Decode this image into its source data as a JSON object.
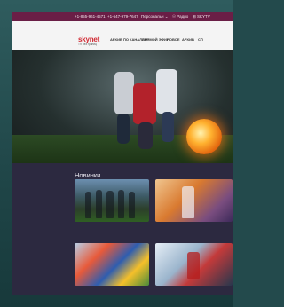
{
  "topbar": {
    "phone1": "+1-855-961-4571",
    "phone2": "+1-647-979-7647",
    "account": "Персональн ⌄",
    "radio": "☉ Радио",
    "extra": "⊞ SKYTV"
  },
  "header": {
    "logo_main": "skynet",
    "logo_sub": "TV без границ",
    "nav": [
      "АРХИВ ПО КАНАЛАМ",
      "ПРЯМОЙ ЭФИР",
      "НОВОЕ",
      "АРХИВ",
      "СП"
    ]
  },
  "section": {
    "title": "Новинки"
  },
  "colors": {
    "topbar": "#6a1e46",
    "brand": "#d12b34",
    "content_bg": "#2c2940"
  }
}
